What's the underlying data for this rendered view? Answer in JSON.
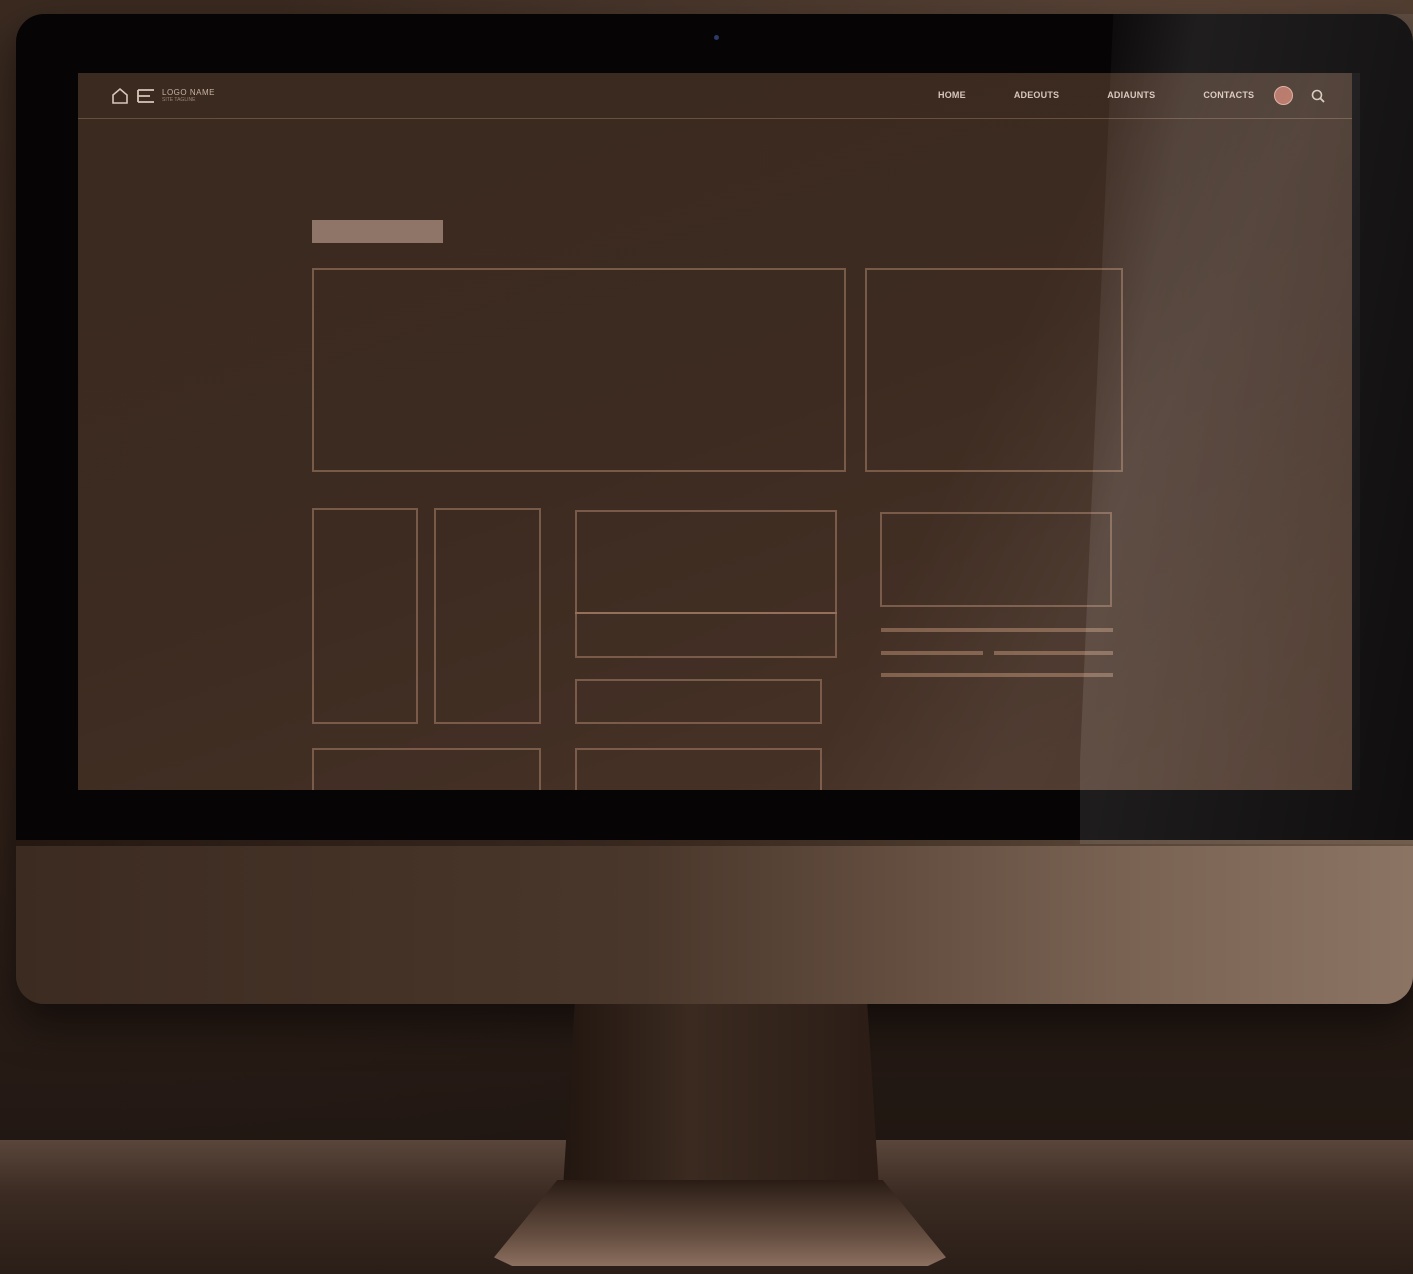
{
  "site": {
    "logo_title": "LOGO NAME",
    "logo_sub": "SITE TAGLINE"
  },
  "nav": {
    "items": [
      {
        "label": "HOME"
      },
      {
        "label": "ADEOUTS"
      },
      {
        "label": "ADIAUNTS"
      },
      {
        "label": "CONTACTS"
      }
    ],
    "avatar_icon": "user-avatar-icon",
    "search_icon": "search-icon"
  },
  "colors": {
    "screen_bg": "#3d2b21",
    "wireframe_stroke": "#aa8269",
    "title_block": "#8f7567",
    "nav_text": "#d7c6ba",
    "bezel": "#060404"
  }
}
